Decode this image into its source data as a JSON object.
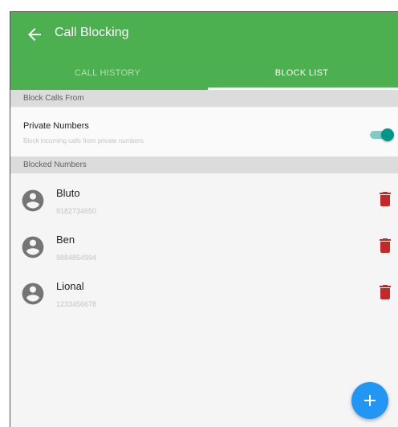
{
  "app_bar": {
    "title": "Call Blocking",
    "back_icon": "arrow-back-icon"
  },
  "tabs": [
    {
      "label": "CALL HISTORY",
      "active": false
    },
    {
      "label": "BLOCK LIST",
      "active": true
    }
  ],
  "block_calls_from": {
    "header": "Block Calls From",
    "private_numbers": {
      "title": "Private Numbers",
      "subtitle": "Block incoming calls from private numbers",
      "enabled": true
    }
  },
  "blocked_numbers": {
    "header": "Blocked Numbers",
    "items": [
      {
        "name": "Bluto",
        "number": "9182734650"
      },
      {
        "name": "Ben",
        "number": "9884854994"
      },
      {
        "name": "Lional",
        "number": "1233456678"
      }
    ]
  },
  "fab": {
    "icon": "plus-icon"
  },
  "colors": {
    "app_bar": "#4caf50",
    "toggle_on": "#009688",
    "delete_icon": "#c62828",
    "fab": "#2196f3"
  }
}
